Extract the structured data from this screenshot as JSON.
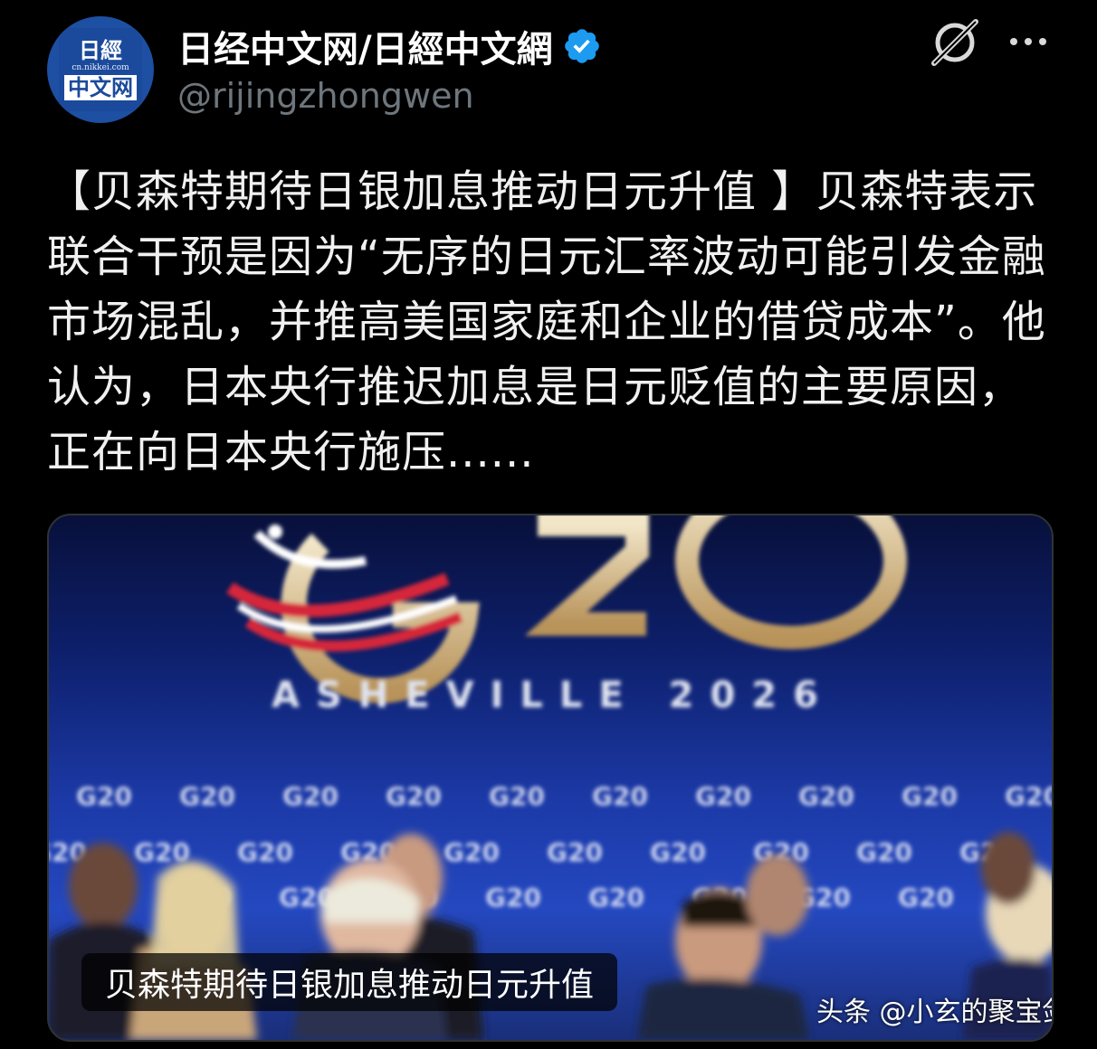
{
  "header": {
    "avatar": {
      "line1": "日經",
      "url": "cn.nikkei.com",
      "line2": "中文网"
    },
    "display_name": "日经中文网/日經中文網",
    "handle": "@rijingzhongwen",
    "verified_icon": "verified-badge-icon",
    "grok_icon": "grok-icon",
    "more_icon": "more-icon"
  },
  "tweet": {
    "text": "【贝森特期待日银加息推动日元升值 】贝森特表示联合干预是因为“无序的日元汇率波动可能引发金融市场混乱，并推高美国家庭和企业的借贷成本”。他认为，日本央行推迟加息是日元贬值的主要原因，正在向日本央行施压......"
  },
  "media": {
    "logo_text": "G20",
    "event_text": "ASHEVILLE  2026",
    "backdrop_text": "G20",
    "caption": "贝森特期待日银加息推动日元升值",
    "watermark": "头条 @小玄的聚宝剑"
  },
  "colors": {
    "background": "#000000",
    "verified": "#1d9bf0",
    "handle": "#6e767d"
  }
}
